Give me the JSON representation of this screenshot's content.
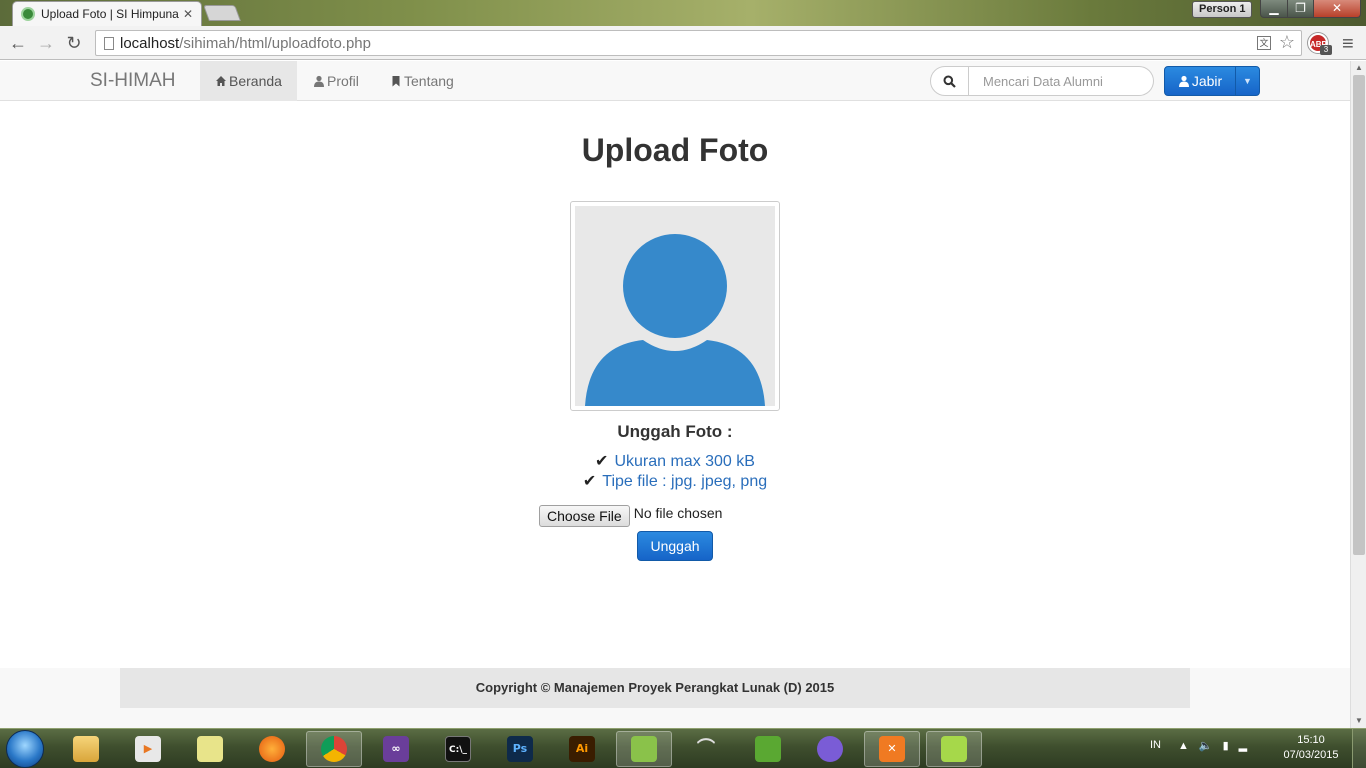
{
  "browser": {
    "tab_title": "Upload Foto | SI Himpuna",
    "profile_label": "Person 1",
    "url_host": "localhost",
    "url_path": "/sihimah/html/uploadfoto.php",
    "adblock_label": "ABP",
    "adblock_count": "3"
  },
  "navbar": {
    "brand": "SI-HIMAH",
    "items": [
      {
        "label": "Beranda",
        "icon": "home-icon",
        "active": true
      },
      {
        "label": "Profil",
        "icon": "user-icon",
        "active": false
      },
      {
        "label": "Tentang",
        "icon": "bookmark-icon",
        "active": false
      }
    ],
    "search_placeholder": "Mencari Data Alumni",
    "user_label": "Jabir"
  },
  "main": {
    "title": "Upload Foto",
    "upload_heading": "Unggah Foto :",
    "requirements": [
      "Ukuran max 300 kB",
      "Tipe file : jpg. jpeg, png"
    ],
    "file_button": "Choose File",
    "file_status": "No file chosen",
    "submit_label": "Unggah"
  },
  "footer": {
    "text": "Copyright © Manajemen Proyek Perangkat Lunak (D) 2015"
  },
  "taskbar": {
    "apps": [
      {
        "name": "file-explorer",
        "open": false
      },
      {
        "name": "media-player",
        "open": false
      },
      {
        "name": "sticky-notes",
        "open": false
      },
      {
        "name": "firefox",
        "open": false
      },
      {
        "name": "chrome",
        "open": true
      },
      {
        "name": "visual-studio",
        "open": false
      },
      {
        "name": "command-prompt",
        "open": false
      },
      {
        "name": "photoshop",
        "open": false
      },
      {
        "name": "illustrator",
        "open": false
      },
      {
        "name": "notepad-plus",
        "open": true
      },
      {
        "name": "arc-app",
        "open": false
      },
      {
        "name": "evernote",
        "open": false
      },
      {
        "name": "cat-app",
        "open": false
      },
      {
        "name": "xampp",
        "open": true
      },
      {
        "name": "notepad-editor",
        "open": true
      }
    ],
    "language": "IN",
    "time": "15:10",
    "date": "07/03/2015"
  },
  "colors": {
    "primary": "#1b73d2",
    "link": "#2a6ebb",
    "avatar_fill": "#3689cb"
  }
}
